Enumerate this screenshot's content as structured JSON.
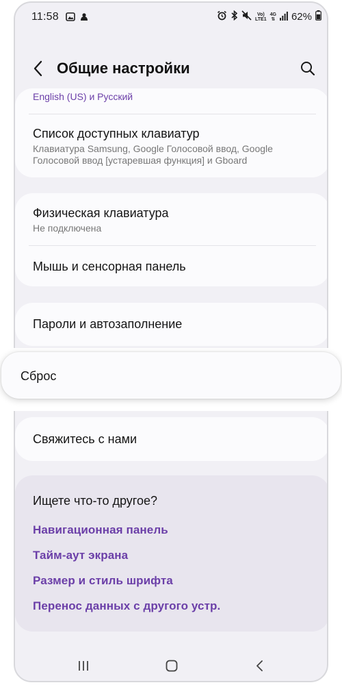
{
  "status_bar": {
    "time": "11:58",
    "battery": "62%",
    "net_top": "Vo)",
    "net_bottom": "LTE1",
    "net_4g": "4G"
  },
  "header": {
    "title": "Общие настройки"
  },
  "card1": {
    "language_sub": "English (US) и Русский",
    "keyboards_title": "Список доступных клавиатур",
    "keyboards_sub": "Клавиатура Samsung, Google Голосовой ввод, Google Голосовой ввод [устаревшая функция] и Gboard"
  },
  "card2": {
    "physical_title": "Физическая клавиатура",
    "physical_sub": "Не подключена",
    "mouse_title": "Мышь и сенсорная панель"
  },
  "card3": {
    "passwords_title": "Пароли и автозаполнение"
  },
  "reset": {
    "title": "Сброс"
  },
  "card5": {
    "contact_title": "Свяжитесь с нами"
  },
  "suggestions": {
    "title": "Ищете что-то другое?",
    "links": [
      "Навигационная панель",
      "Тайм-аут экрана",
      "Размер и стиль шрифта",
      "Перенос данных с другого устр."
    ]
  },
  "colors": {
    "accent": "#6b3fa8",
    "background": "#f1f0f5",
    "card": "#fbfbfd",
    "suggest_bg": "#e8e5ee"
  },
  "icons": {
    "status_left": [
      "image-icon",
      "fox-icon"
    ],
    "status_right": [
      "alarm-icon",
      "bluetooth-icon",
      "mute-icon",
      "signal-icon",
      "battery-icon"
    ],
    "header": [
      "back-arrow-icon",
      "search-icon"
    ],
    "nav": [
      "recents-icon",
      "home-icon",
      "back-icon"
    ]
  }
}
